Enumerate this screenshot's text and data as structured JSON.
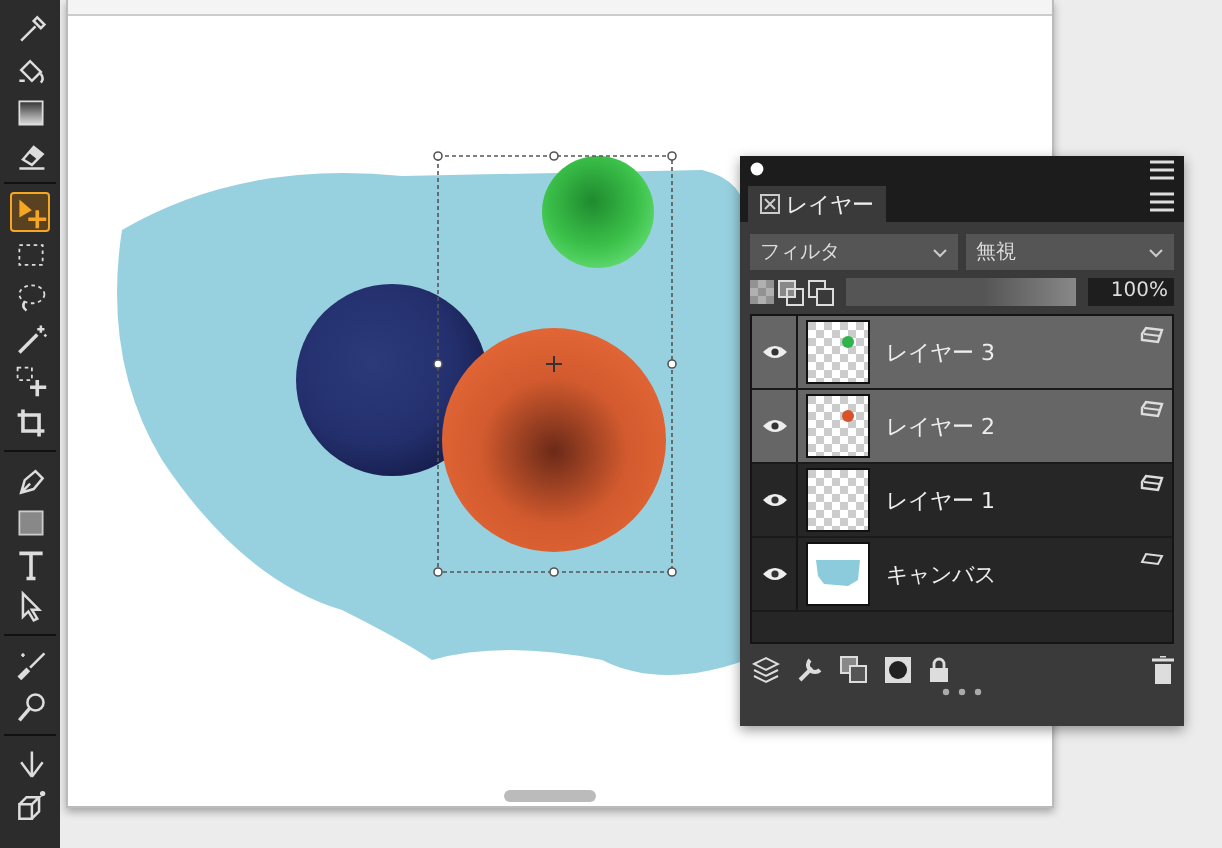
{
  "toolbar": {
    "tools": [
      {
        "kind": "eyedropper",
        "selected": false
      },
      {
        "kind": "fill",
        "selected": false
      },
      {
        "kind": "gradient",
        "selected": false
      },
      {
        "kind": "eraser",
        "selected": false
      },
      {
        "kind": "separator"
      },
      {
        "kind": "move",
        "selected": true
      },
      {
        "kind": "rect-select",
        "selected": false
      },
      {
        "kind": "lasso",
        "selected": false
      },
      {
        "kind": "wand",
        "selected": false
      },
      {
        "kind": "transform",
        "selected": false
      },
      {
        "kind": "crop",
        "selected": false
      },
      {
        "kind": "separator"
      },
      {
        "kind": "pen",
        "selected": false
      },
      {
        "kind": "shape",
        "selected": false
      },
      {
        "kind": "text",
        "selected": false
      },
      {
        "kind": "pointer",
        "selected": false
      },
      {
        "kind": "separator"
      },
      {
        "kind": "brush",
        "selected": false
      },
      {
        "kind": "blur",
        "selected": false
      },
      {
        "kind": "separator"
      },
      {
        "kind": "warp",
        "selected": false
      },
      {
        "kind": "cube",
        "selected": false
      }
    ]
  },
  "layers_panel": {
    "tab": {
      "label": "レイヤー"
    },
    "filter": {
      "value": "フィルタ"
    },
    "blend_mode": {
      "value": "無視"
    },
    "opacity": {
      "level": 1,
      "reading": "100%"
    },
    "layers": [
      {
        "name": "レイヤー 3",
        "selected": true,
        "visible": true,
        "thumbnail": {
          "kind": "dot",
          "color": "#2fb34a"
        }
      },
      {
        "name": "レイヤー 2",
        "selected": true,
        "visible": true,
        "thumbnail": {
          "kind": "dot",
          "color": "#d9532a"
        }
      },
      {
        "name": "レイヤー 1",
        "selected": false,
        "visible": true,
        "thumbnail": {
          "kind": "empty"
        }
      },
      {
        "name": "キャンバス",
        "selected": false,
        "visible": true,
        "thumbnail": {
          "kind": "canvas"
        }
      }
    ]
  }
}
